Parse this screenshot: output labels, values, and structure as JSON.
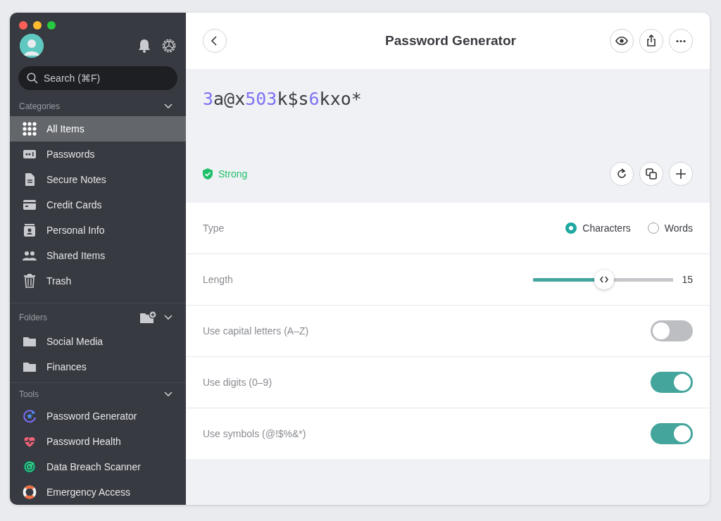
{
  "sidebar": {
    "search": {
      "placeholder": "Search (⌘F)"
    },
    "categories": {
      "title": "Categories",
      "expanded": true,
      "items": [
        {
          "label": "All Items",
          "selected": true
        },
        {
          "label": "Passwords",
          "selected": false
        },
        {
          "label": "Secure Notes",
          "selected": false
        },
        {
          "label": "Credit Cards",
          "selected": false
        },
        {
          "label": "Personal Info",
          "selected": false
        },
        {
          "label": "Shared Items",
          "selected": false
        },
        {
          "label": "Trash",
          "selected": false
        }
      ]
    },
    "folders": {
      "title": "Folders",
      "expanded": true,
      "items": [
        {
          "label": "Social Media",
          "selected": false
        },
        {
          "label": "Finances",
          "selected": false
        }
      ]
    },
    "tools": {
      "title": "Tools",
      "expanded": true,
      "items": [
        {
          "label": "Password Generator",
          "selected": false
        },
        {
          "label": "Password Health",
          "selected": false
        },
        {
          "label": "Data Breach Scanner",
          "selected": false
        },
        {
          "label": "Emergency Access",
          "selected": false
        }
      ]
    }
  },
  "header": {
    "title": "Password Generator"
  },
  "password": {
    "segments": [
      {
        "text": "3",
        "kind": "digit"
      },
      {
        "text": "a@x",
        "kind": "other"
      },
      {
        "text": "503",
        "kind": "digit"
      },
      {
        "text": "k$s",
        "kind": "other"
      },
      {
        "text": "6",
        "kind": "digit"
      },
      {
        "text": "kxo*",
        "kind": "other"
      }
    ],
    "strength": "Strong"
  },
  "settings": [
    {
      "kind": "radio",
      "label": "Type",
      "options": [
        {
          "label": "Characters",
          "selected": true
        },
        {
          "label": "Words",
          "selected": false
        }
      ]
    },
    {
      "kind": "slider",
      "label": "Length",
      "level": 0.51,
      "reading": "15"
    },
    {
      "kind": "toggle",
      "label": "Use capital letters (A–Z)",
      "on": false
    },
    {
      "kind": "toggle",
      "label": "Use digits (0–9)",
      "on": true
    },
    {
      "kind": "toggle",
      "label": "Use symbols (@!$%&*)",
      "on": true
    }
  ]
}
